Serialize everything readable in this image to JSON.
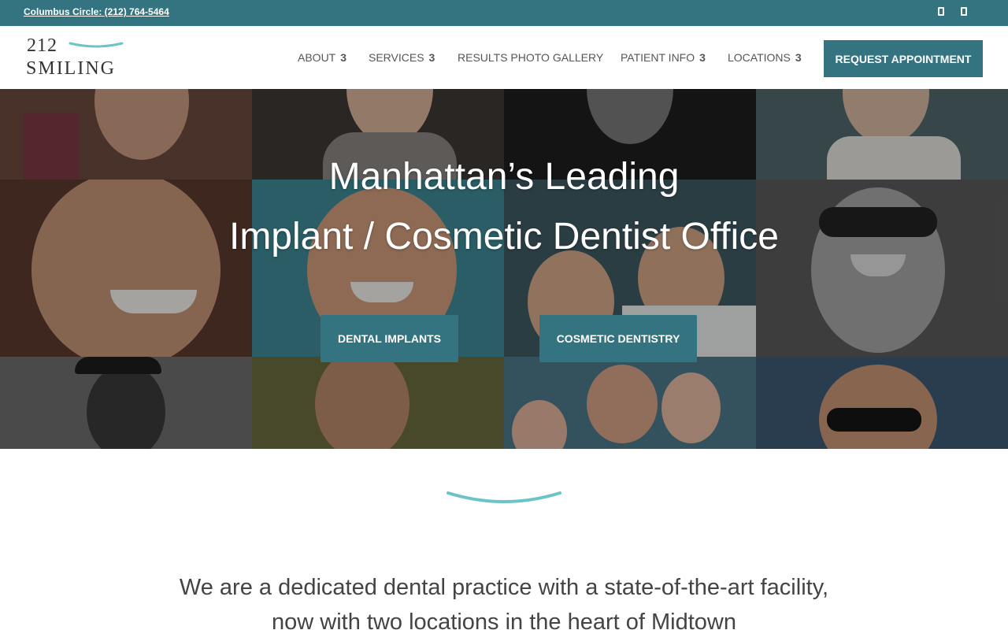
{
  "topbar": {
    "phone_link": "Columbus Circle: (212) 764-5464",
    "social_icons": [
      "facebook-icon",
      "instagram-icon"
    ]
  },
  "logo": {
    "number": "212",
    "word": "SMILING",
    "accent_color": "#6cc3c8"
  },
  "nav": {
    "items": [
      {
        "label": "ABOUT",
        "chevron": "3"
      },
      {
        "label": "SERVICES",
        "chevron": "3"
      },
      {
        "label": "RESULTS PHOTO GALLERY",
        "chevron": ""
      },
      {
        "label": "PATIENT INFO",
        "chevron": "3"
      },
      {
        "label": "LOCATIONS",
        "chevron": "3"
      }
    ],
    "cta_label": "REQUEST APPOINTMENT"
  },
  "hero": {
    "title_line1": "Manhattan’s Leading",
    "title_line2": "Implant / Cosmetic Dentist Office",
    "buttons": [
      {
        "label": "DENTAL IMPLANTS"
      },
      {
        "label": "COSMETIC DENTISTRY"
      }
    ]
  },
  "intro": {
    "text": "We are a dedicated dental practice with a state-of-the-art facility, now with two locations in the heart of Midtown"
  },
  "colors": {
    "brand_teal": "#347481",
    "accent_teal": "#6cc3c8"
  }
}
